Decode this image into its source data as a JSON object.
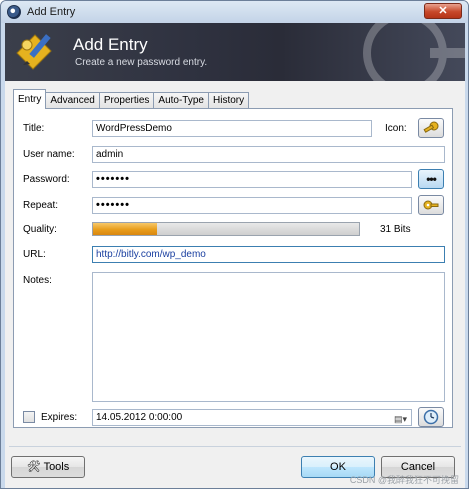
{
  "window": {
    "title": "Add Entry",
    "close_label": "✕"
  },
  "banner": {
    "title": "Add Entry",
    "subtitle": "Create a new password entry."
  },
  "tabs": [
    {
      "label": "Entry",
      "active": true
    },
    {
      "label": "Advanced",
      "active": false
    },
    {
      "label": "Properties",
      "active": false
    },
    {
      "label": "Auto-Type",
      "active": false
    },
    {
      "label": "History",
      "active": false
    }
  ],
  "form": {
    "title_label": "Title:",
    "title_value": "WordPressDemo",
    "icon_label": "Icon:",
    "username_label": "User name:",
    "username_value": "admin",
    "password_label": "Password:",
    "password_value": "•••••••",
    "repeat_label": "Repeat:",
    "repeat_value": "•••••••",
    "quality_label": "Quality:",
    "quality_text": "31 Bits",
    "quality_fraction": 0.24,
    "url_label": "URL:",
    "url_value": "http://bitly.com/wp_demo",
    "notes_label": "Notes:",
    "notes_value": "",
    "expires_label": "Expires:",
    "expires_value": "14.05.2012   0:00:00",
    "expires_checked": false
  },
  "buttons": {
    "tools": "Tools",
    "ok": "OK",
    "cancel": "Cancel"
  },
  "watermark": "CSDN @我醉我狂不可挽留",
  "colors": {
    "banner": "#2f3240",
    "quality_fill": "#e89d1b",
    "accent": "#3c7fb1"
  }
}
